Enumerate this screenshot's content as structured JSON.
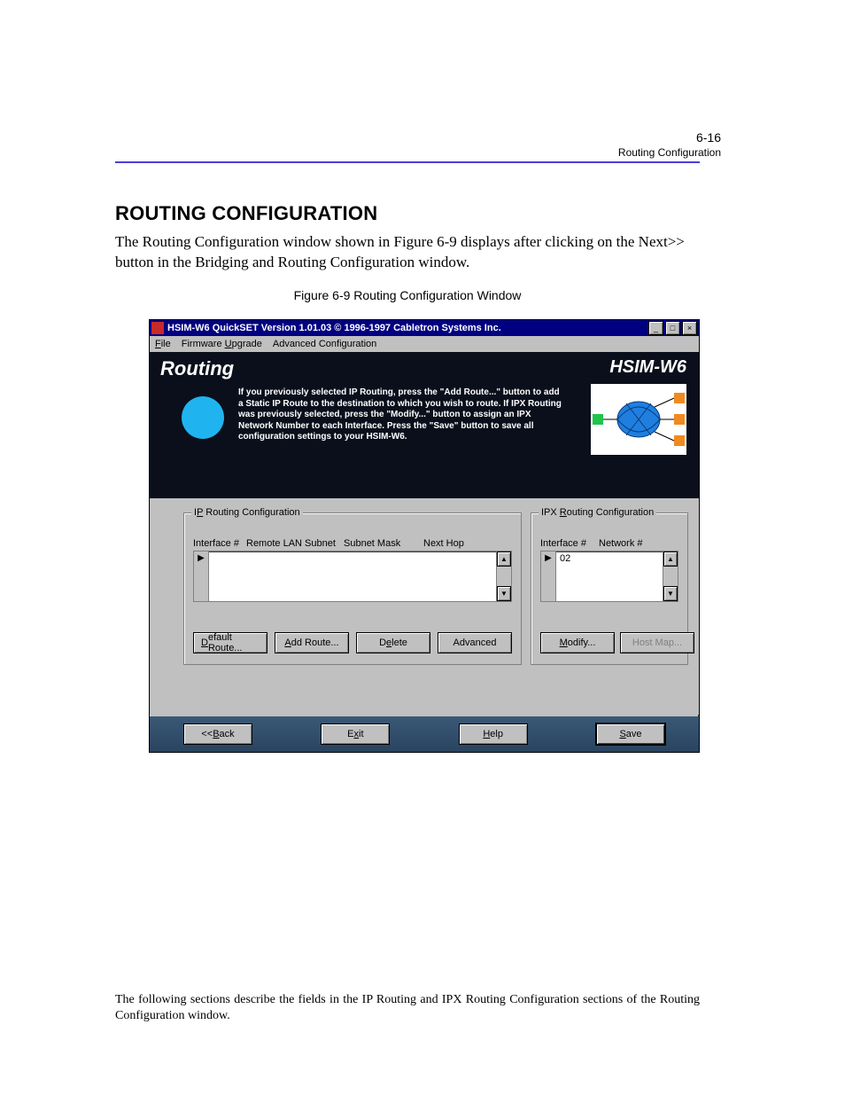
{
  "page_number": "6-16",
  "running_head": "Routing Configuration",
  "section_title": "ROUTING CONFIGURATION",
  "intro_text": "The Routing Configuration window shown in Figure 6-9 displays after clicking on the Next>> button in the Bridging and Routing Configuration window.",
  "figure_caption": "Figure 6-9   Routing Configuration Window",
  "window": {
    "title": "HSIM-W6 QuickSET Version 1.01.03 ©  1996-1997 Cabletron Systems Inc.",
    "min": "_",
    "max": "□",
    "close": "×",
    "menu": {
      "file": "File",
      "firmware": "Firmware Upgrade",
      "advanced": "Advanced Configuration"
    },
    "hero": {
      "title": "Routing",
      "brand": "HSIM-W6",
      "text": "If you previously selected IP Routing, press the \"Add Route...\" button to add a Static IP Route to the destination to which you wish to route.  If IPX Routing was previously selected, press the \"Modify...\" button to assign an IPX Network Number to each Interface.  Press the \"Save\" button to save all configuration settings to your HSIM-W6."
    },
    "ip": {
      "legend": "IP Routing Configuration",
      "cols": {
        "c1": "Interface #",
        "c2": "Remote LAN Subnet",
        "c3": "Subnet Mask",
        "c4": "Next Hop"
      },
      "rowmark": "▶",
      "buttons": {
        "default": "Default Route...",
        "add": "Add Route...",
        "delete": "Delete",
        "advanced": "Advanced"
      }
    },
    "ipx": {
      "legend": "IPX Routing Configuration",
      "cols": {
        "c1": "Interface #",
        "c2": "Network #"
      },
      "rowmark": "▶",
      "row_value": "02",
      "buttons": {
        "modify": "Modify...",
        "hostmap": "Host Map..."
      }
    },
    "scroll": {
      "up": "▲",
      "down": "▼"
    },
    "footer": {
      "back": "<< Back",
      "exit": "Exit",
      "help": "Help",
      "save": "Save"
    }
  },
  "footer_text": "The following sections describe the fields in the IP Routing and IPX Routing Configuration sections of the Routing Configuration window."
}
